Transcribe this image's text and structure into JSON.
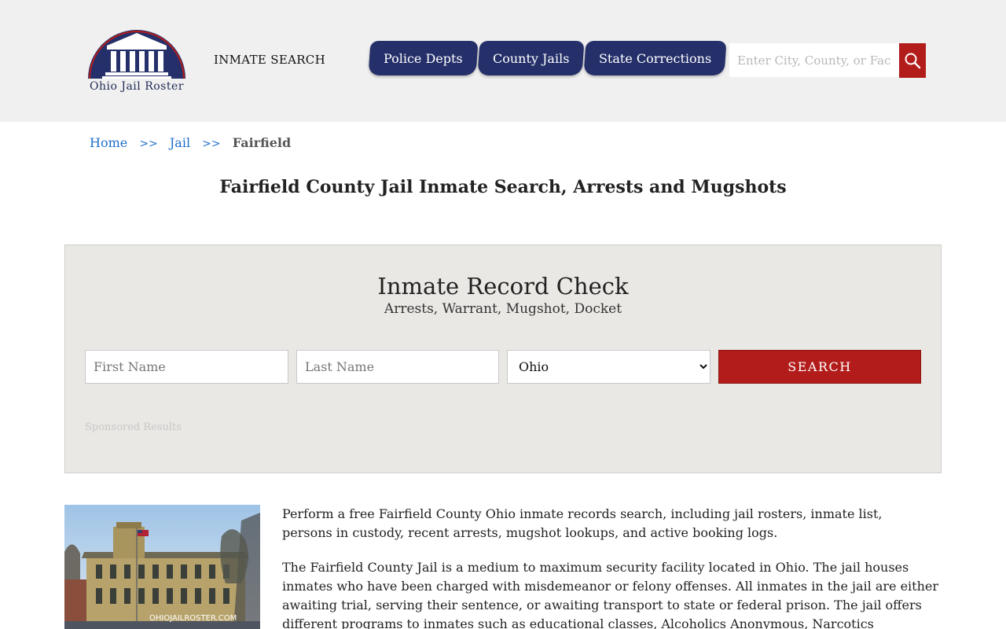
{
  "header": {
    "logo_text": "Ohio Jail Roster",
    "inmate_search_label": "INMATE SEARCH",
    "nav": [
      "Police Depts",
      "County Jails",
      "State Corrections"
    ],
    "search_placeholder": "Enter City, County, or Facility",
    "search_icon": "search-icon"
  },
  "breadcrumb": {
    "home": "Home",
    "sep": ">>",
    "jail": "Jail",
    "current": "Fairfield"
  },
  "page_title": "Fairfield County Jail Inmate Search, Arrests and Mugshots",
  "record_check": {
    "title": "Inmate Record Check",
    "subtitle": "Arrests, Warrant, Mugshot, Docket",
    "first_name_placeholder": "First Name",
    "last_name_placeholder": "Last Name",
    "state_selected": "Ohio",
    "search_label": "SEARCH",
    "sponsored": "Sponsored Results"
  },
  "content": {
    "photo_watermark": "OHIOJAILROSTER.COM",
    "paragraph1": "Perform a free Fairfield County Ohio inmate records search, including jail rosters, inmate list, persons in custody, recent arrests, mugshot lookups, and active booking logs.",
    "paragraph2": "The Fairfield County Jail is a medium to maximum security facility located in Ohio. The jail houses inmates who have been charged with misdemeanor or felony offenses. All inmates in the jail are either awaiting trial, serving their sentence, or awaiting transport to state or federal prison. The jail offers different programs to inmates such as educational classes, Alcoholics Anonymous, Narcotics Anonymous and anger management."
  },
  "colors": {
    "navy": "#25306a",
    "red": "#b21d1b",
    "link": "#1e6fc9"
  }
}
